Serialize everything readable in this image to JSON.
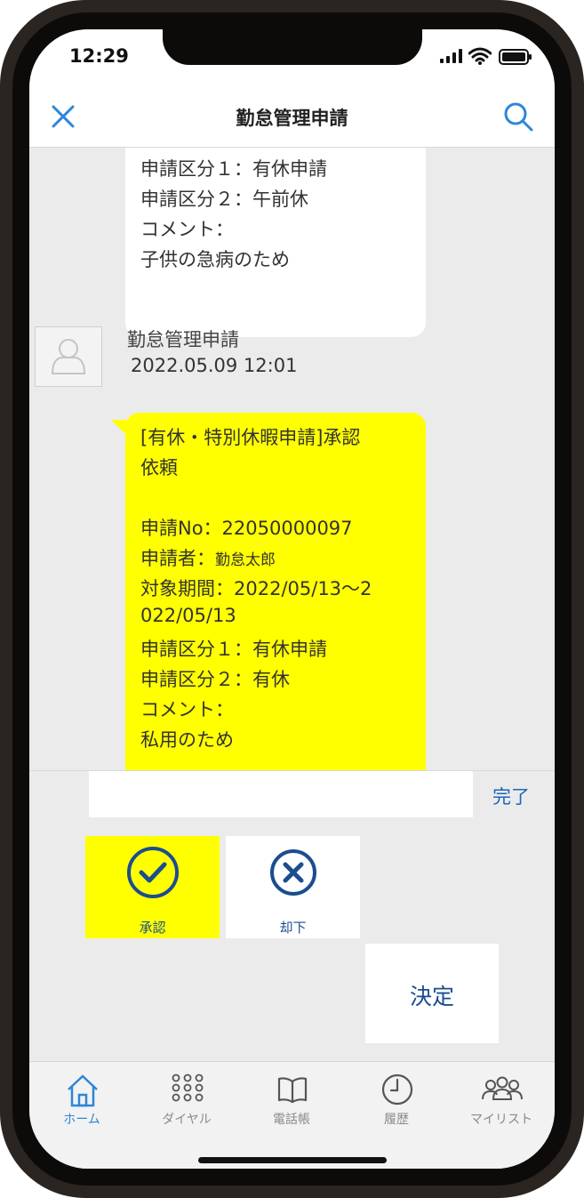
{
  "status_bar": {
    "time": "12:29"
  },
  "header": {
    "title": "勤怠管理申請"
  },
  "messages": {
    "prev_bubble_lines": [
      "申請区分１：有休申請",
      "申請区分２：午前休",
      "コメント：",
      "子供の急病のため"
    ],
    "latest": {
      "sender": "勤怠管理申請",
      "timestamp": "2022.05.09 12:01",
      "line1": "[有休・特別休暇申請]承認",
      "line2": "依頼",
      "request_no": "申請No：22050000097",
      "applicant_label": "申請者：",
      "applicant_name": "勤怠太郎",
      "period_line1": "対象期間：2022/05/13～2",
      "period_line2": "022/05/13",
      "category1": "申請区分１：有休申請",
      "category2": "申請区分２：有休",
      "comment_label": "コメント：",
      "comment": "私用のため"
    }
  },
  "input": {
    "value": "",
    "done_label": "完了"
  },
  "actions": {
    "approve_label": "承認",
    "reject_label": "却下",
    "decide_label": "決定"
  },
  "tabs": [
    {
      "label": "ホーム",
      "icon": "home-icon"
    },
    {
      "label": "ダイヤル",
      "icon": "dialpad-icon"
    },
    {
      "label": "電話帳",
      "icon": "book-icon"
    },
    {
      "label": "履歴",
      "icon": "clock-icon"
    },
    {
      "label": "マイリスト",
      "icon": "group-icon"
    }
  ],
  "colors": {
    "accent": "#2d86d8",
    "highlight": "#ffff00",
    "navy": "#1b4d8f"
  }
}
